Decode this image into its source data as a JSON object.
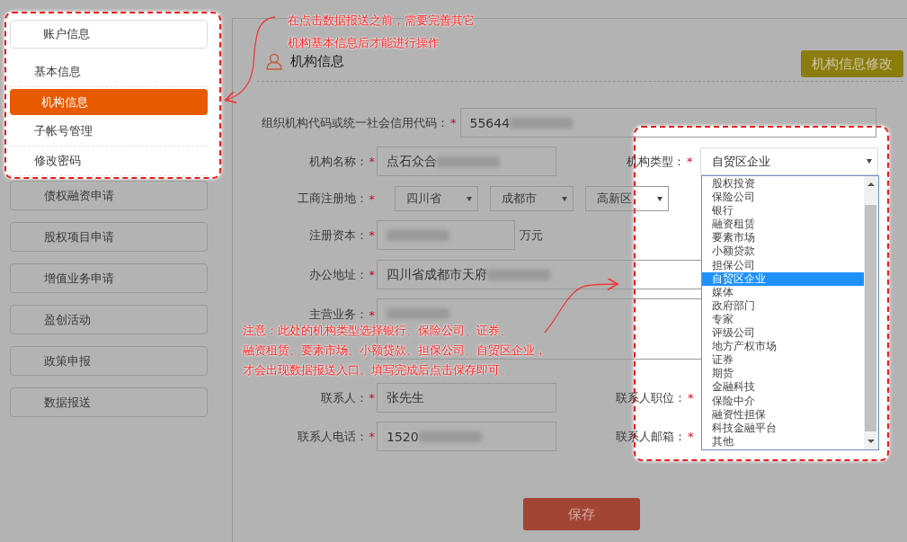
{
  "sidebar": {
    "header": "账户信息",
    "items": [
      {
        "label": "基本信息",
        "selected": false
      },
      {
        "label": "机构信息",
        "selected": true
      },
      {
        "label": "子帐号管理",
        "selected": false
      },
      {
        "label": "修改密码",
        "selected": false
      }
    ],
    "menu_buttons": [
      "债权融资申请",
      "股权项目申请",
      "增值业务申请",
      "盈创活动",
      "政策申报",
      "数据报送"
    ]
  },
  "page_title": "机构信息",
  "edit_button": "机构信息修改",
  "form": {
    "credit_code": {
      "label": "组织机构代码或统一社会信用代码：",
      "required_mark": "*",
      "value": "55644",
      "blurred": true
    },
    "name": {
      "label": "机构名称：",
      "required_mark": "*",
      "value": "点石众合",
      "blurred": true
    },
    "org_type": {
      "label": "机构类型：",
      "required_mark": "*",
      "value": "自贸区企业",
      "options": [
        {
          "label": "股权投资",
          "selected": false
        },
        {
          "label": "保险公司",
          "selected": false
        },
        {
          "label": "银行",
          "selected": false
        },
        {
          "label": "融资租赁",
          "selected": false
        },
        {
          "label": "要素市场",
          "selected": false
        },
        {
          "label": "小额贷款",
          "selected": false
        },
        {
          "label": "担保公司",
          "selected": false
        },
        {
          "label": "自贸区企业",
          "selected": true
        },
        {
          "label": "媒体",
          "selected": false
        },
        {
          "label": "政府部门",
          "selected": false
        },
        {
          "label": "专家",
          "selected": false
        },
        {
          "label": "评级公司",
          "selected": false
        },
        {
          "label": "地方产权市场",
          "selected": false
        },
        {
          "label": "证券",
          "selected": false
        },
        {
          "label": "期货",
          "selected": false
        },
        {
          "label": "金融科技",
          "selected": false
        },
        {
          "label": "保险中介",
          "selected": false
        },
        {
          "label": "融资性担保",
          "selected": false
        },
        {
          "label": "科技金融平台",
          "selected": false
        },
        {
          "label": "其他",
          "selected": false
        }
      ]
    },
    "registered_place": {
      "label": "工商注册地：",
      "required_mark": "*",
      "selects": [
        "四川省",
        "成都市",
        "高新区"
      ]
    },
    "capital": {
      "label": "注册资本：",
      "required_mark": "*",
      "blurred": true,
      "unit": "万元"
    },
    "address": {
      "label": "办公地址：",
      "required_mark": "*",
      "value": "四川省成都市天府",
      "blurred": true
    },
    "business": {
      "label": "主营业务：",
      "required_mark": "*",
      "blurred": true
    },
    "contact": {
      "label": "联系人：",
      "required_mark": "*",
      "value": "张先生"
    },
    "contact_title": {
      "label": "联系人职位：",
      "required_mark": "*"
    },
    "phone": {
      "label": "联系人电话：",
      "required_mark": "*",
      "value": "1520",
      "blurred": true
    },
    "email": {
      "label": "联系人邮箱：",
      "required_mark": "*"
    }
  },
  "save_button": "保存",
  "annotations": [
    {
      "lines": [
        "在点击数据报送之前，需要完善其它",
        "机构基本信息后才能进行操作"
      ]
    },
    {
      "lines": [
        "注意：此处的机构类型选择银行、保险公司、证券、",
        "融资租赁、要素市场、小额贷款、担保公司、自贸区企业，",
        "才会出现数据报送入口。填写完成后点击保存即可。"
      ]
    }
  ]
}
